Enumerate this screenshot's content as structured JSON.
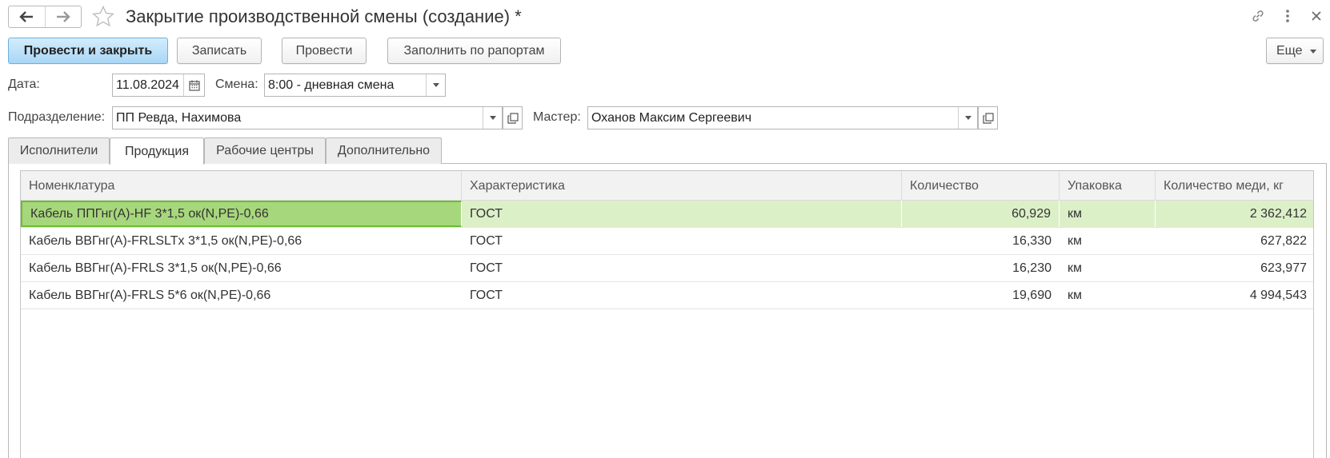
{
  "window": {
    "title": "Закрытие производственной смены (создание) *"
  },
  "toolbar": {
    "post_close": "Провести и закрыть",
    "save": "Записать",
    "post": "Провести",
    "fill_from_reports": "Заполнить по рапортам",
    "more": "Еще"
  },
  "form": {
    "date_label": "Дата:",
    "date_value": "11.08.2024",
    "shift_label": "Смена:",
    "shift_value": "8:00 - дневная смена",
    "division_label": "Подразделение:",
    "division_value": "ПП Ревда, Нахимова",
    "master_label": "Мастер:",
    "master_value": "Оханов Максим Сергеевич"
  },
  "tabs": [
    {
      "label": "Исполнители",
      "active": false
    },
    {
      "label": "Продукция",
      "active": true
    },
    {
      "label": "Рабочие центры",
      "active": false
    },
    {
      "label": "Дополнительно",
      "active": false
    }
  ],
  "table": {
    "columns": [
      "Номенклатура",
      "Характеристика",
      "Количество",
      "Упаковка",
      "Количество меди, кг"
    ],
    "rows": [
      [
        "Кабель ППГнг(А)-HF 3*1,5 ок(N,PE)-0,66",
        "ГОСТ",
        "60,929",
        "км",
        "2 362,412"
      ],
      [
        "Кабель ВВГнг(А)-FRLSLTx 3*1,5 ок(N,PE)-0,66",
        "ГОСТ",
        "16,330",
        "км",
        "627,822"
      ],
      [
        "Кабель ВВГнг(А)-FRLS 3*1,5 ок(N,PE)-0,66",
        "ГОСТ",
        "16,230",
        "км",
        "623,977"
      ],
      [
        "Кабель ВВГнг(А)-FRLS 5*6 ок(N,PE)-0,66",
        "ГОСТ",
        "19,690",
        "км",
        "4 994,543"
      ]
    ],
    "selected_row": 0
  },
  "icons": {
    "back": "arrow-left-icon",
    "forward": "arrow-right-icon",
    "favorite": "star-icon",
    "link": "link-icon",
    "menu": "more-vertical-icon",
    "close": "close-icon",
    "calendar": "calendar-icon",
    "open": "open-form-icon"
  },
  "colors": {
    "primary_button": "#a9d7f6",
    "selected_row": "#dcf0c8",
    "focused_cell": "#a7d77c",
    "focused_border": "#6cbd2f"
  }
}
